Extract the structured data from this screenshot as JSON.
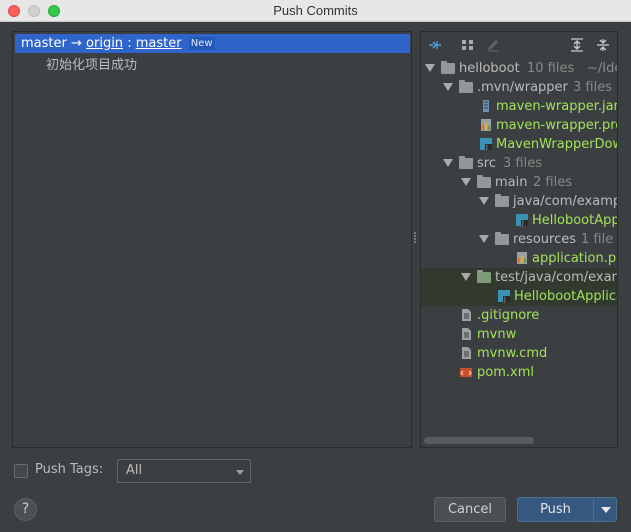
{
  "window": {
    "title": "Push Commits"
  },
  "branch": {
    "local": "master",
    "arrow": "→",
    "remote": "origin",
    "sep": ":",
    "remote_branch": "master",
    "badge": "New"
  },
  "commits": [
    {
      "message": "初始化项目成功"
    }
  ],
  "tree": {
    "root": {
      "name": "helloboot",
      "count": "10 files",
      "path": "~/Idea"
    },
    "mvn": {
      "name": ".mvn/wrapper",
      "count": "3 files"
    },
    "mvn_jar": "maven-wrapper.jar",
    "mvn_props": "maven-wrapper.pro",
    "mvn_downloader": "MavenWrapperDown",
    "src": {
      "name": "src",
      "count": "3 files"
    },
    "main": {
      "name": "main",
      "count": "2 files"
    },
    "java": {
      "name": "java/com/examp"
    },
    "app_class": "HellobootApp",
    "resources": {
      "name": "resources",
      "count": "1 file"
    },
    "app_props": "application.pr",
    "test": {
      "name": "test/java/com/exar"
    },
    "test_class": "HellobootApplica",
    "gitignore": ".gitignore",
    "mvnw": "mvnw",
    "mvnw_cmd": "mvnw.cmd",
    "pom": "pom.xml"
  },
  "footer": {
    "push_tags_label": "Push Tags:",
    "tags_value": "All",
    "help": "?",
    "cancel": "Cancel",
    "push": "Push"
  },
  "colors": {
    "selection": "#2f65ca",
    "added_file": "#a2e25a",
    "push_button": "#365880"
  }
}
